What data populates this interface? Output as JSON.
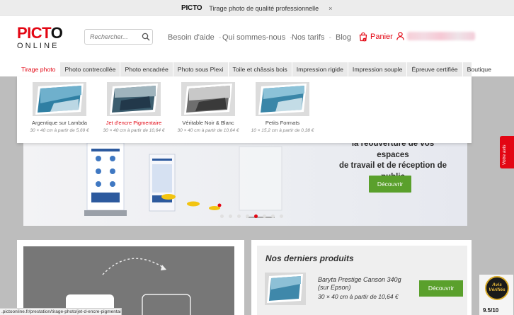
{
  "topbar": {
    "logo": "PICTO",
    "text": "Tirage photo de qualité professionnelle",
    "close": "×"
  },
  "logo": {
    "line1_red": "PICT",
    "line1_dark": "O",
    "line2": "ONLINE"
  },
  "search": {
    "placeholder": "Rechercher..."
  },
  "nav": [
    {
      "label": "Besoin d'aide",
      "dropdown": true
    },
    {
      "label": "Qui sommes-nous",
      "dropdown": true
    },
    {
      "label": "Nos tarifs",
      "dropdown": true
    },
    {
      "label": "Blog",
      "dropdown": false
    }
  ],
  "cart": {
    "label": "Panier",
    "count": "0"
  },
  "categories": [
    "Tirage photo",
    "Photo contrecollée",
    "Photo encadrée",
    "Photo sous Plexi",
    "Toile et châssis bois",
    "Impression rigide",
    "Impression souple",
    "Épreuve certifiée",
    "Boutique"
  ],
  "dropdown": [
    {
      "name": "Argentique sur Lambda",
      "price": "30 × 40 cm à partir de 5,69 €",
      "active": false
    },
    {
      "name": "Jet d'encre Pigmentaire",
      "price": "30 × 40 cm à partir de 10,64 €",
      "active": true
    },
    {
      "name": "Véritable Noir & Blanc",
      "price": "30 × 40 cm à partir de 10,64 €",
      "active": false
    },
    {
      "name": "Petits Formats",
      "price": "10 × 15,2 cm à partir de 0,38 €",
      "active": false
    }
  ],
  "banner": {
    "head_lines": [
      "la réouverture de vos espaces",
      "de travail et de réception de",
      "public"
    ],
    "button": "Découvrir"
  },
  "latest": {
    "title": "Nos derniers produits",
    "product_name": "Baryta Prestige Canson 340g (sur Epson)",
    "product_price": "30 × 40 cm à partir de 10,64 €",
    "button": "Découvrir"
  },
  "status_url": ".pictoonline.fr/prestation/tirage-photo/jet-d-encre-pigmentaire",
  "side_tab": "Votre avis",
  "avis_badge": {
    "seal_line1": "Avis",
    "seal_line2": "Vérifiés",
    "score": "9.5/10"
  },
  "colors": {
    "brand_red": "#e30613",
    "cta_green": "#5aa02c",
    "category_bg": "#e9e9e9"
  }
}
